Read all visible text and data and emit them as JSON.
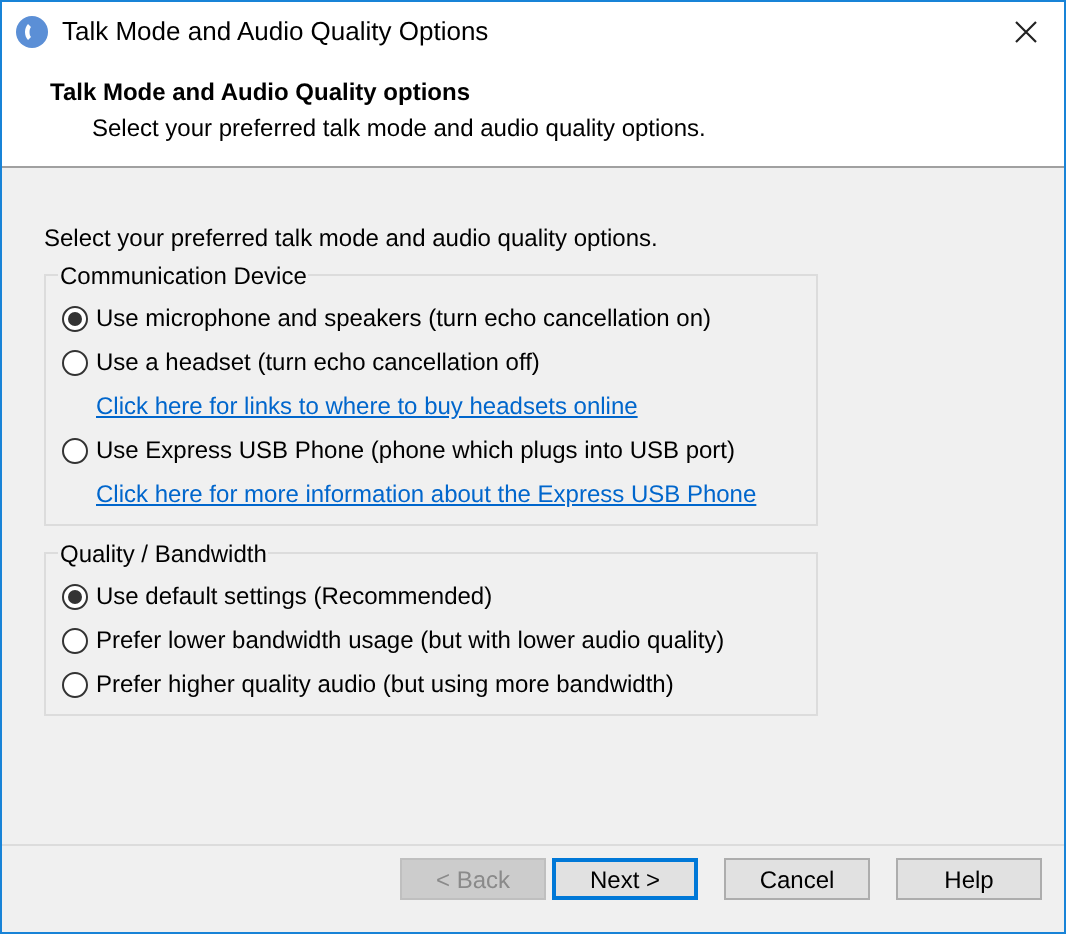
{
  "window": {
    "title": "Talk Mode and Audio Quality Options"
  },
  "header": {
    "title": "Talk Mode and Audio Quality options",
    "subtitle": "Select your preferred talk mode and audio quality options."
  },
  "intro": "Select your preferred talk mode and audio quality options.",
  "groups": [
    {
      "title": "Communication Device",
      "items": [
        {
          "kind": "radio",
          "label": "Use microphone and speakers (turn echo cancellation on)",
          "selected": true
        },
        {
          "kind": "radio",
          "label": "Use a headset (turn echo cancellation off)",
          "selected": false
        },
        {
          "kind": "link",
          "label": "Click here for links to where to buy headsets online"
        },
        {
          "kind": "radio",
          "label": "Use Express USB Phone (phone which plugs into USB port)",
          "selected": false
        },
        {
          "kind": "link",
          "label": "Click here for more information about the Express USB Phone"
        }
      ]
    },
    {
      "title": "Quality / Bandwidth",
      "items": [
        {
          "kind": "radio",
          "label": "Use default settings (Recommended)",
          "selected": true
        },
        {
          "kind": "radio",
          "label": "Prefer lower bandwidth usage (but with lower audio quality)",
          "selected": false
        },
        {
          "kind": "radio",
          "label": "Prefer higher quality audio (but using more bandwidth)",
          "selected": false
        }
      ]
    }
  ],
  "buttons": [
    {
      "label": "< Back",
      "disabled": true,
      "default": false
    },
    {
      "label": "Next >",
      "disabled": false,
      "default": true
    },
    {
      "label": "Cancel",
      "disabled": false,
      "default": false
    },
    {
      "label": "Help",
      "disabled": false,
      "default": false
    }
  ]
}
